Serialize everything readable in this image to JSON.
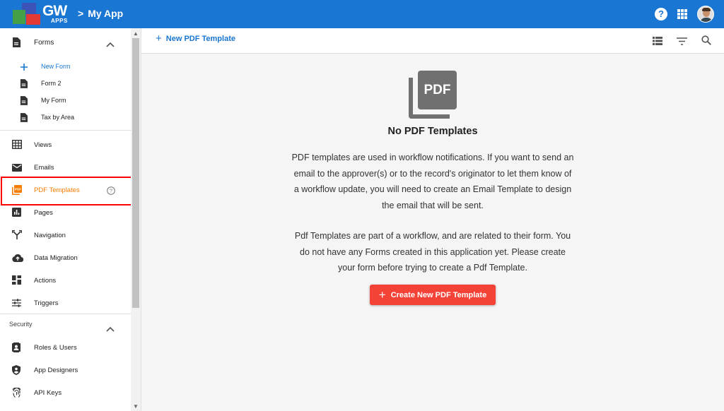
{
  "header": {
    "logo_text": "GW",
    "logo_sub": "APPS",
    "breadcrumb_sep": ">",
    "app_name": "My App",
    "help_glyph": "?"
  },
  "sidebar": {
    "forms_section": {
      "label": "Forms",
      "icon": "document-icon"
    },
    "form_items": [
      {
        "label": "New Form",
        "icon": "plus-icon"
      },
      {
        "label": "Form 2",
        "icon": "document-icon"
      },
      {
        "label": "My Form",
        "icon": "document-icon"
      },
      {
        "label": "Tax by Area",
        "icon": "document-icon"
      }
    ],
    "nav_items": [
      {
        "label": "Views",
        "icon": "table-icon"
      },
      {
        "label": "Emails",
        "icon": "envelope-icon"
      },
      {
        "label": "PDF Templates",
        "icon": "pdf-icon",
        "active": true
      },
      {
        "label": "Pages",
        "icon": "chart-icon"
      },
      {
        "label": "Navigation",
        "icon": "fork-icon"
      },
      {
        "label": "Data Migration",
        "icon": "cloud-upload-icon"
      },
      {
        "label": "Actions",
        "icon": "dashboard-icon"
      },
      {
        "label": "Triggers",
        "icon": "sliders-icon"
      }
    ],
    "security_section": {
      "label": "Security"
    },
    "security_items": [
      {
        "label": "Roles & Users",
        "icon": "contact-icon"
      },
      {
        "label": "App Designers",
        "icon": "shield-icon"
      },
      {
        "label": "API Keys",
        "icon": "fingerprint-icon"
      }
    ]
  },
  "toolbar": {
    "new_label": "New PDF Template",
    "icons": [
      "list-icon",
      "filter-icon",
      "search-icon"
    ]
  },
  "empty_state": {
    "art_text": "PDF",
    "title": "No PDF Templates",
    "para1": "PDF templates are used in workflow notifications. If you want to send an email to the approver(s) or to the record's originator to let them know of a workflow update, you will need to create an Email Template to design the email that will be sent.",
    "para2": "Pdf Templates are part of a workflow, and are related to their form. You do not have any Forms created in this application yet. Please create your form before trying to create a Pdf Template.",
    "button_label": "Create New PDF Template"
  },
  "colors": {
    "header_bg": "#1976d2",
    "accent_blue": "#1976d2",
    "active_orange": "#f57c00",
    "button_red": "#f44336",
    "highlight_border": "#ff0000"
  }
}
